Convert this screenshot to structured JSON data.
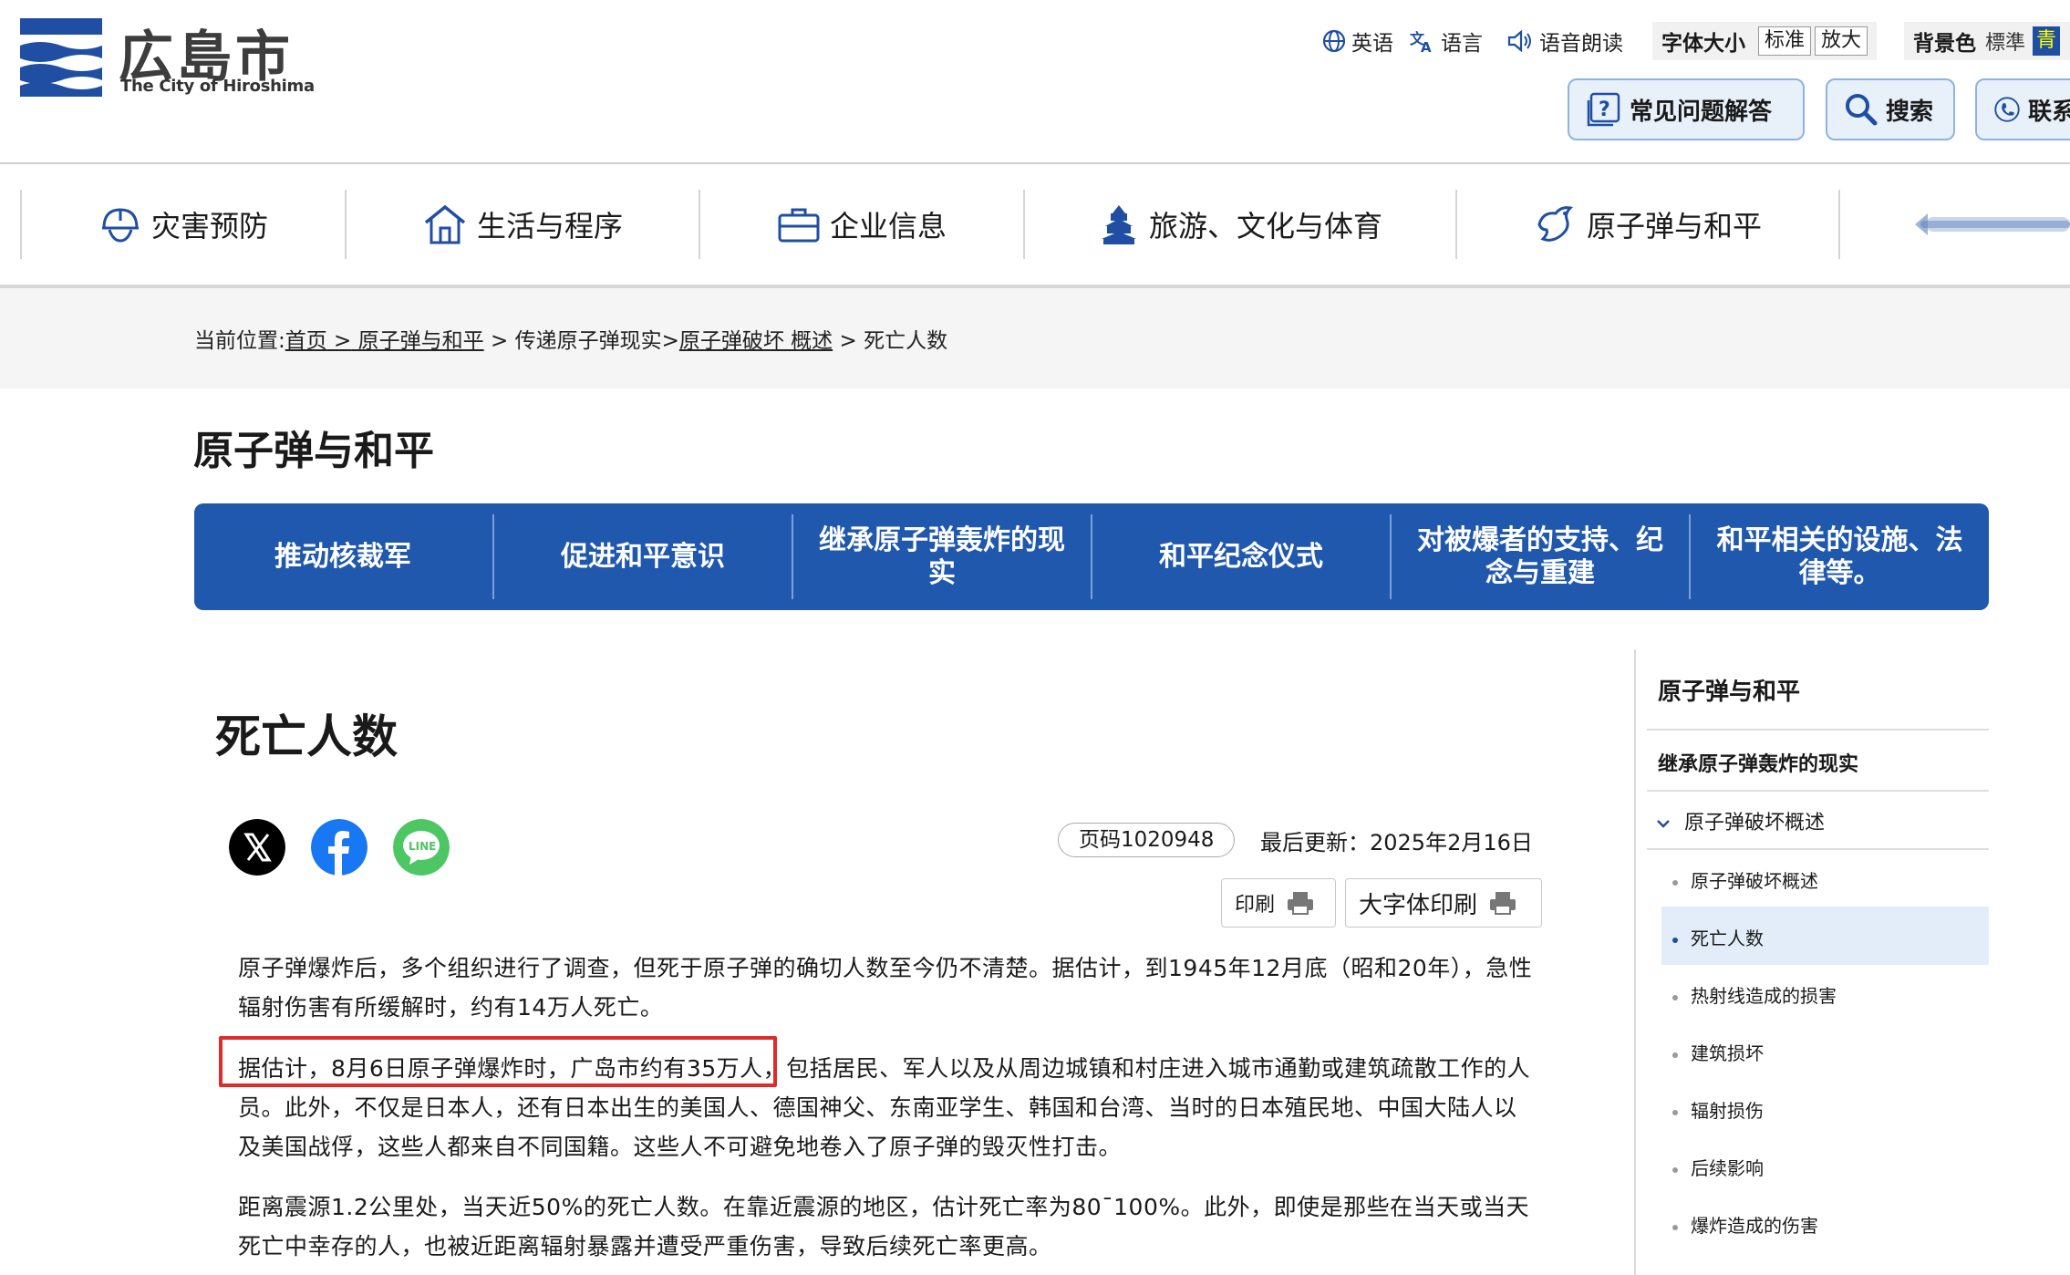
{
  "header": {
    "logo_jp": "広島市",
    "logo_en": "The City of Hiroshima",
    "utils": {
      "english": "英语",
      "language": "语言",
      "read_aloud": "语音朗读"
    },
    "font_size": {
      "label": "字体大小",
      "standard": "标准",
      "large": "放大"
    },
    "bg_color": {
      "label": "背景色",
      "standard": "標準",
      "blue": "青"
    },
    "buttons": {
      "faq": "常见问题解答",
      "search": "搜索",
      "contact": "联系"
    }
  },
  "nav": [
    "灾害预防",
    "生活与程序",
    "企业信息",
    "旅游、文化与体育",
    "原子弹与和平"
  ],
  "breadcrumb": {
    "label": "当前位置:",
    "home": "首页",
    "gt1": " >",
    "atomic": " 原子弹与和平",
    "gt2": " > ",
    "convey": "传递原子弹现实>",
    "overview": "原子弹破坏 概述",
    "gt3": " > ",
    "current": "死亡人数"
  },
  "section_title": "原子弹与和平",
  "subnav": [
    "推动核裁军",
    "促进和平意识",
    "继承原子弹轰炸的现实",
    "和平纪念仪式",
    "对被爆者的支持、纪念与重建",
    "和平相关的设施、法律等。"
  ],
  "page": {
    "title": "死亡人数",
    "page_id": "页码1020948",
    "updated": "最后更新：2025年2月16日",
    "print": "印刷",
    "large_print": "大字体印刷",
    "paragraphs": [
      "原子弹爆炸后，多个组织进行了调查，但死于原子弹的确切人数至今仍不清楚。据估计，到1945年12月底（昭和20年），急性辐射伤害有所缓解时，约有14万人死亡。",
      "据估计，8月6日原子弹爆炸时，广岛市约有35万人，包括居民、军人以及从周边城镇和村庄进入城市通勤或建筑疏散工作的人员。此外，不仅是日本人，还有日本出生的美国人、德国神父、东南亚学生、韩国和台湾、当时的日本殖民地、中国大陆人以及美国战俘，这些人都来自不同国籍。这些人不可避免地卷入了原子弹的毁灭性打击。",
      "距离震源1.2公里处，当天近50%的死亡人数。在靠近震源的地区，估计死亡率为80ˉ100%。此外，即使是那些在当天或当天死亡中幸存的人，也被近距离辐射暴露并遭受严重伤害，导致后续死亡率更高。"
    ]
  },
  "sidebar": {
    "title": "原子弹与和平",
    "section": "继承原子弹轰炸的现实",
    "group": "原子弹破坏概述",
    "items": [
      "原子弹破坏概述",
      "死亡人数",
      "热射线造成的损害",
      "建筑损坏",
      "辐射损伤",
      "后续影响",
      "爆炸造成的伤害"
    ]
  },
  "colors": {
    "nav_blue": "#1f58ad",
    "highlight_red": "#e02b2b",
    "logo_blue": "#1f4ea3"
  }
}
